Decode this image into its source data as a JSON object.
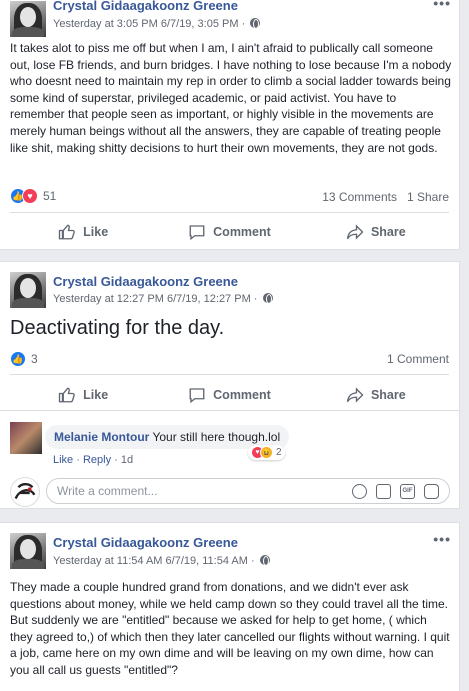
{
  "posts": [
    {
      "author": "Crystal Gidaagakoonz Greene",
      "timestamp": "Yesterday at 3:05 PM",
      "date": "6/7/19, 3:05 PM",
      "separator": "·",
      "text": "It takes alot to piss me off but when I am, I ain't afraid to publically call someone out, lose FB friends, and burn bridges. I have nothing to lose because I'm a nobody who doesnt need to maintain my rep in order to climb a social ladder towards being some kind of superstar, privileged academic, or paid activist. You have to remember that people seen as important, or highly visible in the movements are merely human beings without all the answers, they are capable of treating people like shit, making shitty decisions to hurt their own movements, they are not gods.",
      "reaction_count": "51",
      "comments_count": "13 Comments",
      "shares_count": "1 Share"
    },
    {
      "author": "Crystal Gidaagakoonz Greene",
      "timestamp": "Yesterday at 12:27 PM",
      "date": "6/7/19, 12:27 PM",
      "separator": "·",
      "text": "Deactivating for the day.",
      "reaction_count": "3",
      "comments_count": "1 Comment"
    },
    {
      "author": "Crystal Gidaagakoonz Greene",
      "timestamp": "Yesterday at 11:54 AM",
      "date": "6/7/19, 11:54 AM",
      "separator": "·",
      "text": "They made a couple hundred grand from donations, and we didn't ever ask questions about money, while we held camp down so they could travel all the time. But suddenly we are \"entitled\" because we asked for help to get home, ( which they agreed to,) of which then they later cancelled our flights without warning. I quit a job, came here on my own dime and will be leaving on my own dime, how can you all call us guests \"entitled\"?"
    }
  ],
  "actions": {
    "like": "Like",
    "comment": "Comment",
    "share": "Share"
  },
  "comment": {
    "author": "Melanie Montour",
    "text": "Your still here though.lol",
    "like": "Like",
    "reply": "Reply",
    "sep": "·",
    "age": "1d",
    "reaction_count": "2"
  },
  "write_comment": {
    "placeholder": "Write a comment..."
  },
  "more_menu": "•••",
  "colors": {
    "link": "#385898",
    "like_blue": "#1877f2",
    "love_red": "#f33e58",
    "background": "#e9ebee"
  },
  "icons": [
    "globe-icon",
    "like-thumb-icon",
    "comment-bubble-icon",
    "share-arrow-icon",
    "emoji-icon",
    "camera-icon",
    "gif-icon",
    "sticker-icon"
  ]
}
